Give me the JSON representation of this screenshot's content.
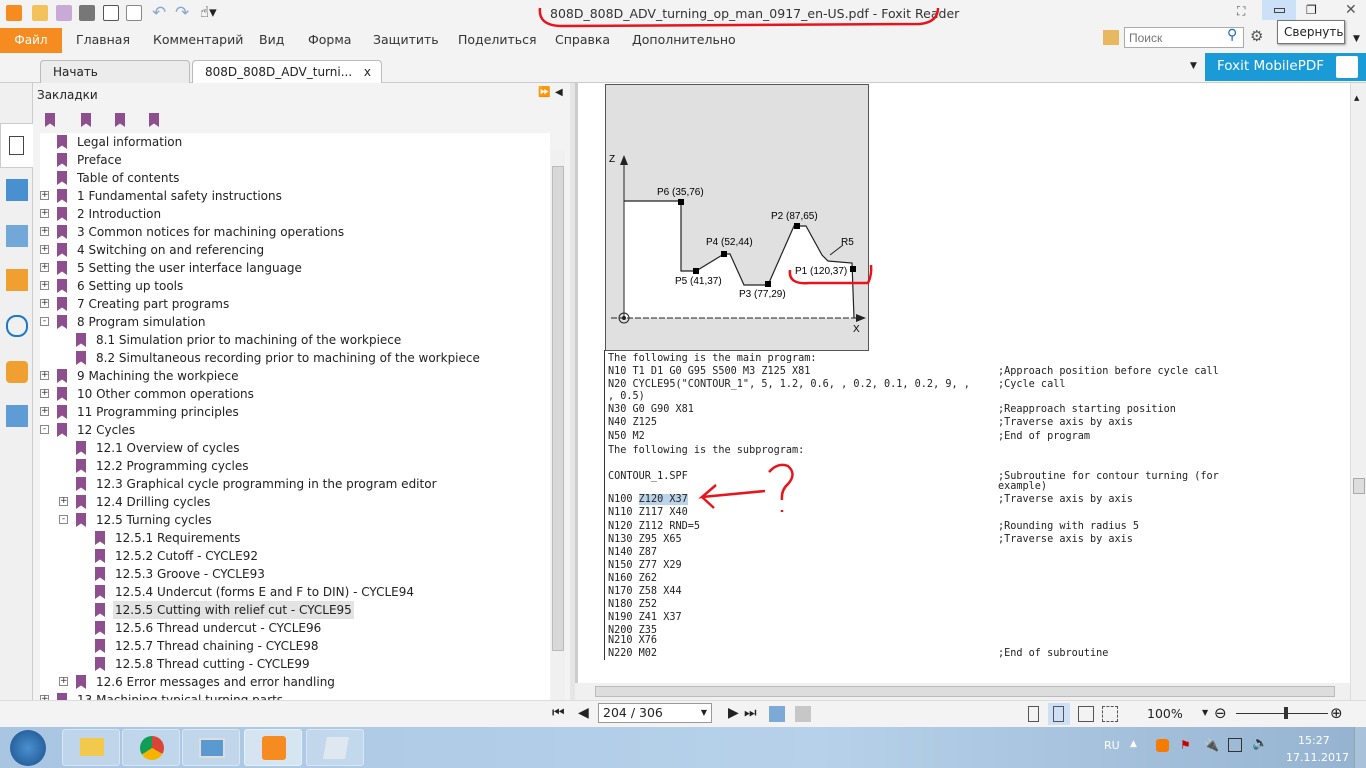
{
  "window": {
    "title": "808D_808D_ADV_turning_op_man_0917_en-US.pdf - Foxit Reader",
    "tooltip": "Свернуть"
  },
  "menu": {
    "file": "Файл",
    "items": [
      "Главная",
      "Комментарий",
      "Вид",
      "Форма",
      "Защитить",
      "Поделиться",
      "Справка",
      "Дополнительно"
    ]
  },
  "search": {
    "placeholder": "Поиск"
  },
  "tabs": [
    {
      "label": "Начать"
    },
    {
      "label": "808D_808D_ADV_turni...",
      "close": "x"
    }
  ],
  "mobile_pdf": "Foxit MobilePDF",
  "bookmarks": {
    "title": "Закладки",
    "items": [
      {
        "label": "Legal information",
        "level": 0
      },
      {
        "label": "Preface",
        "level": 0
      },
      {
        "label": "Table of contents",
        "level": 0
      },
      {
        "label": "1 Fundamental safety instructions",
        "level": 0,
        "expand": "+"
      },
      {
        "label": "2 Introduction",
        "level": 0,
        "expand": "+"
      },
      {
        "label": "3 Common notices for machining operations",
        "level": 0,
        "expand": "+"
      },
      {
        "label": "4 Switching on and referencing",
        "level": 0,
        "expand": "+"
      },
      {
        "label": "5 Setting the user interface language",
        "level": 0,
        "expand": "+"
      },
      {
        "label": "6 Setting up tools",
        "level": 0,
        "expand": "+"
      },
      {
        "label": "7 Creating part programs",
        "level": 0,
        "expand": "+"
      },
      {
        "label": "8 Program simulation",
        "level": 0,
        "expand": "-"
      },
      {
        "label": "8.1 Simulation prior to machining of the workpiece",
        "level": 1
      },
      {
        "label": "8.2 Simultaneous recording prior to machining of the workpiece",
        "level": 1
      },
      {
        "label": "9 Machining the workpiece",
        "level": 0,
        "expand": "+"
      },
      {
        "label": "10 Other common operations",
        "level": 0,
        "expand": "+"
      },
      {
        "label": "11 Programming principles",
        "level": 0,
        "expand": "+"
      },
      {
        "label": "12 Cycles",
        "level": 0,
        "expand": "-"
      },
      {
        "label": "12.1 Overview of cycles",
        "level": 1
      },
      {
        "label": "12.2 Programming cycles",
        "level": 1
      },
      {
        "label": "12.3 Graphical cycle programming in the program editor",
        "level": 1
      },
      {
        "label": "12.4 Drilling cycles",
        "level": 1,
        "expand": "+"
      },
      {
        "label": "12.5 Turning cycles",
        "level": 1,
        "expand": "-"
      },
      {
        "label": "12.5.1 Requirements",
        "level": 2
      },
      {
        "label": "12.5.2 Cutoff - CYCLE92",
        "level": 2
      },
      {
        "label": "12.5.3 Groove - CYCLE93",
        "level": 2
      },
      {
        "label": "12.5.4 Undercut (forms E and F to DIN) - CYCLE94",
        "level": 2
      },
      {
        "label": "12.5.5 Cutting with relief cut - CYCLE95",
        "level": 2,
        "selected": true
      },
      {
        "label": "12.5.6 Thread undercut - CYCLE96",
        "level": 2
      },
      {
        "label": "12.5.7 Thread chaining - CYCLE98",
        "level": 2
      },
      {
        "label": "12.5.8 Thread cutting - CYCLE99",
        "level": 2
      },
      {
        "label": "12.6 Error messages and error handling",
        "level": 1,
        "expand": "+"
      },
      {
        "label": "13 Machining typical turning parts",
        "level": 0,
        "expand": "+"
      }
    ]
  },
  "figure": {
    "axis_z": "Z",
    "axis_x": "X",
    "radius": "R5",
    "points": [
      {
        "label": "P6 (35,76)"
      },
      {
        "label": "P4 (52,44)"
      },
      {
        "label": "P2 (87,65)"
      },
      {
        "label": "P5 (41,37)"
      },
      {
        "label": "P3 (77,29)"
      },
      {
        "label": "P1 (120,37)"
      }
    ]
  },
  "code": [
    {
      "text": "The following is the main program:",
      "comment": ""
    },
    {
      "text": "N10 T1 D1 G0 G95 S500 M3 Z125 X81",
      "comment": ";Approach position before cycle call"
    },
    {
      "text": "N20 CYCLE95(\"CONTOUR_1\", 5, 1.2, 0.6, , 0.2, 0.1, 0.2, 9, ,",
      "comment": ";Cycle call"
    },
    {
      "text": ", 0.5)",
      "comment": ""
    },
    {
      "text": "N30 G0 G90 X81",
      "comment": ";Reapproach starting position"
    },
    {
      "text": "N40 Z125",
      "comment": ";Traverse axis by axis"
    },
    {
      "text": "N50 M2",
      "comment": ";End of program"
    },
    {
      "text": "The following is the subprogram:",
      "comment": ""
    },
    {
      "text": "CONTOUR_1.SPF",
      "comment": ";Subroutine for contour turning (for"
    },
    {
      "text": "",
      "comment": "example)"
    },
    {
      "text": "N100 ",
      "highlight": "Z120 X37",
      "comment": ";Traverse axis by axis"
    },
    {
      "text": "N110 Z117 X40",
      "comment": ""
    },
    {
      "text": "N120 Z112 RND=5",
      "comment": ";Rounding with radius 5"
    },
    {
      "text": "N130 Z95 X65",
      "comment": ";Traverse axis by axis"
    },
    {
      "text": "N140 Z87",
      "comment": ""
    },
    {
      "text": "N150 Z77 X29",
      "comment": ""
    },
    {
      "text": "N160 Z62",
      "comment": ""
    },
    {
      "text": "N170 Z58 X44",
      "comment": ""
    },
    {
      "text": "N180 Z52",
      "comment": ""
    },
    {
      "text": "N190 Z41 X37",
      "comment": ""
    },
    {
      "text": "N200 Z35",
      "comment": ""
    },
    {
      "text": "N210 X76",
      "comment": ""
    },
    {
      "text": "N220 M02",
      "comment": ";End of subroutine"
    }
  ],
  "nav": {
    "page": "204 / 306",
    "zoom": "100%",
    "zoom_level": 0.55
  },
  "taskbar": {
    "lang": "RU",
    "time": "15:27",
    "date": "17.11.2017"
  },
  "colors": {
    "accent": "#f68b1f",
    "mobile": "#1a9ad6",
    "bookmark": "#8e4f8e",
    "annotation": "#e8141b"
  }
}
